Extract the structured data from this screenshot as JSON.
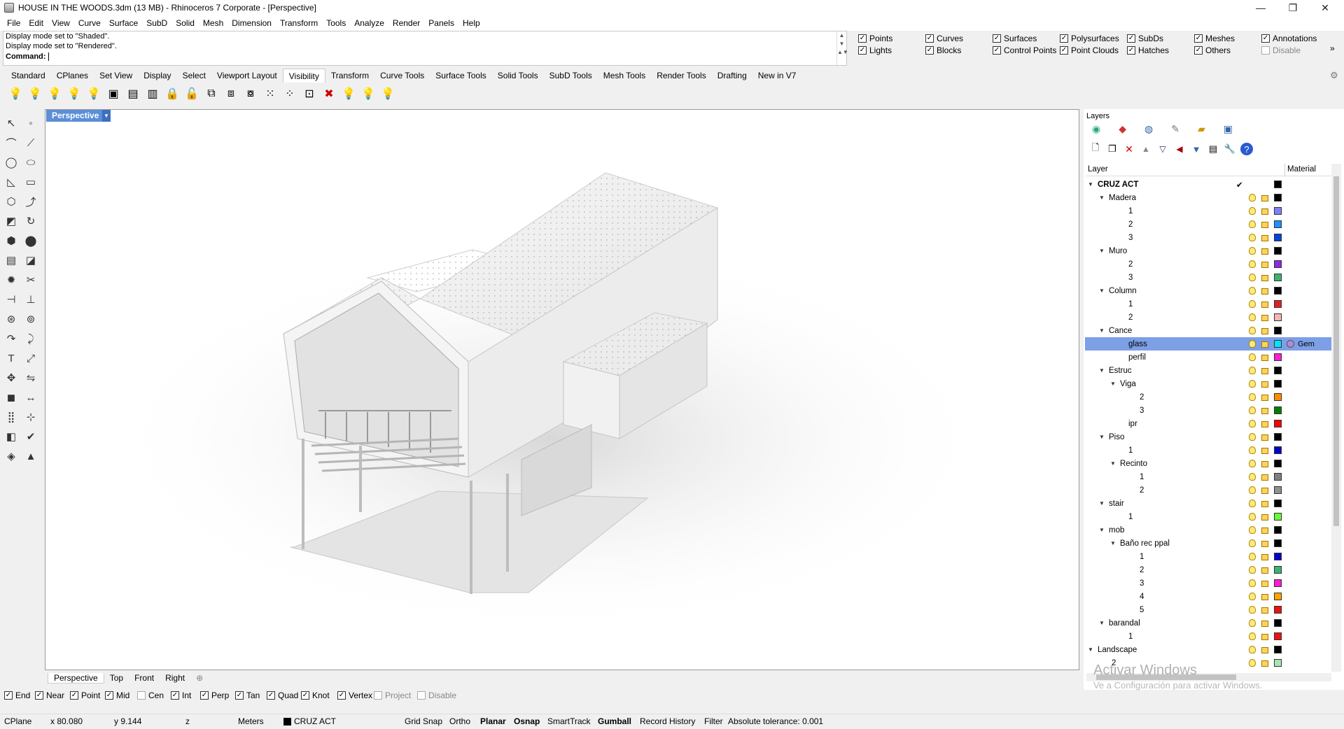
{
  "window": {
    "title": "HOUSE IN THE WOODS.3dm (13 MB) - Rhinoceros 7 Corporate - [Perspective]",
    "min": "—",
    "max": "❐",
    "close": "✕"
  },
  "menu": [
    "File",
    "Edit",
    "View",
    "Curve",
    "Surface",
    "SubD",
    "Solid",
    "Mesh",
    "Dimension",
    "Transform",
    "Tools",
    "Analyze",
    "Render",
    "Panels",
    "Help"
  ],
  "command": {
    "history1": "Display mode set to \"Shaded\".",
    "history2": "Display mode set to \"Rendered\".",
    "prompt": "Command:",
    "value": ""
  },
  "filters": [
    {
      "label": "Points",
      "checked": true
    },
    {
      "label": "Curves",
      "checked": true
    },
    {
      "label": "Surfaces",
      "checked": true
    },
    {
      "label": "Polysurfaces",
      "checked": true
    },
    {
      "label": "SubDs",
      "checked": true
    },
    {
      "label": "Meshes",
      "checked": true
    },
    {
      "label": "Annotations",
      "checked": true
    },
    {
      "label": "Lights",
      "checked": true
    },
    {
      "label": "Blocks",
      "checked": true
    },
    {
      "label": "Control Points",
      "checked": true
    },
    {
      "label": "Point Clouds",
      "checked": true
    },
    {
      "label": "Hatches",
      "checked": true
    },
    {
      "label": "Others",
      "checked": true
    },
    {
      "label": "Disable",
      "checked": false
    }
  ],
  "toolbar_tabs": [
    "Standard",
    "CPlanes",
    "Set View",
    "Display",
    "Select",
    "Viewport Layout",
    "Visibility",
    "Transform",
    "Curve Tools",
    "Surface Tools",
    "Solid Tools",
    "SubD Tools",
    "Mesh Tools",
    "Render Tools",
    "Drafting",
    "New in V7"
  ],
  "active_tab": "Visibility",
  "viewport": {
    "label": "Perspective",
    "tabs": [
      "Perspective",
      "Top",
      "Front",
      "Right"
    ],
    "add": "⊕"
  },
  "osnaps": [
    {
      "label": "End",
      "checked": true
    },
    {
      "label": "Near",
      "checked": true
    },
    {
      "label": "Point",
      "checked": true
    },
    {
      "label": "Mid",
      "checked": true
    },
    {
      "label": "Cen",
      "checked": false
    },
    {
      "label": "Int",
      "checked": true
    },
    {
      "label": "Perp",
      "checked": true
    },
    {
      "label": "Tan",
      "checked": true
    },
    {
      "label": "Quad",
      "checked": true
    },
    {
      "label": "Knot",
      "checked": true
    },
    {
      "label": "Vertex",
      "checked": true
    },
    {
      "label": "Project",
      "checked": false
    },
    {
      "label": "Disable",
      "checked": false
    }
  ],
  "status": {
    "cplane": "CPlane",
    "x": "x 80.080",
    "y": "y 9.144",
    "z": "z",
    "units": "Meters",
    "layer": "CRUZ ACT",
    "grid_snap": "Grid Snap",
    "ortho": "Ortho",
    "planar": "Planar",
    "osnap": "Osnap",
    "smarttrack": "SmartTrack",
    "gumball": "Gumball",
    "record_history": "Record History",
    "filter": "Filter",
    "tolerance": "Absolute tolerance: 0.001"
  },
  "layers_panel": {
    "title": "Layers",
    "col_layer": "Layer",
    "col_material": "Material"
  },
  "layers": [
    {
      "name": "CRUZ ACT",
      "level": 0,
      "expander": "open",
      "bold": true,
      "current": true,
      "color": "#000000"
    },
    {
      "name": "Madera",
      "level": 1,
      "expander": "open",
      "color": "#000000"
    },
    {
      "name": "1",
      "level": 2,
      "color": "#8080ff"
    },
    {
      "name": "2",
      "level": 2,
      "color": "#1e90ff"
    },
    {
      "name": "3",
      "level": 2,
      "color": "#0044dd"
    },
    {
      "name": "Muro",
      "level": 1,
      "expander": "open",
      "color": "#000000"
    },
    {
      "name": "2",
      "level": 2,
      "color": "#8a2be2"
    },
    {
      "name": "3",
      "level": 2,
      "color": "#3cb371"
    },
    {
      "name": "Column",
      "level": 1,
      "expander": "open",
      "color": "#000000"
    },
    {
      "name": "1",
      "level": 2,
      "color": "#e02020"
    },
    {
      "name": "2",
      "level": 2,
      "color": "#f4b6b6"
    },
    {
      "name": "Cance",
      "level": 1,
      "expander": "open",
      "color": "#000000"
    },
    {
      "name": "glass",
      "level": 2,
      "color": "#00e5ff",
      "selected": true,
      "material": "Gem"
    },
    {
      "name": "perfil",
      "level": 2,
      "color": "#ff1cd5"
    },
    {
      "name": "Estruc",
      "level": 1,
      "expander": "open",
      "color": "#000000"
    },
    {
      "name": "Viga",
      "level": 2,
      "expander": "open",
      "color": "#000000"
    },
    {
      "name": "2",
      "level": 3,
      "color": "#ff8c00"
    },
    {
      "name": "3",
      "level": 3,
      "color": "#008000"
    },
    {
      "name": "ipr",
      "level": 2,
      "color": "#ff0000"
    },
    {
      "name": "Piso",
      "level": 1,
      "expander": "open",
      "color": "#000000"
    },
    {
      "name": "1",
      "level": 2,
      "color": "#0000cc"
    },
    {
      "name": "Recinto",
      "level": 2,
      "expander": "open",
      "color": "#000000"
    },
    {
      "name": "1",
      "level": 3,
      "color": "#808080"
    },
    {
      "name": "2",
      "level": 3,
      "color": "#909090"
    },
    {
      "name": "stair",
      "level": 1,
      "expander": "open",
      "color": "#000000"
    },
    {
      "name": "1",
      "level": 2,
      "color": "#66ff33"
    },
    {
      "name": "mob",
      "level": 1,
      "expander": "open",
      "color": "#000000"
    },
    {
      "name": "Baño rec ppal",
      "level": 2,
      "expander": "open",
      "color": "#000000"
    },
    {
      "name": "1",
      "level": 3,
      "color": "#0000cc"
    },
    {
      "name": "2",
      "level": 3,
      "color": "#3cb371"
    },
    {
      "name": "3",
      "level": 3,
      "color": "#ff1cd5"
    },
    {
      "name": "4",
      "level": 3,
      "color": "#ffa500"
    },
    {
      "name": "5",
      "level": 3,
      "color": "#ee1111"
    },
    {
      "name": "barandal",
      "level": 1,
      "expander": "open",
      "color": "#000000"
    },
    {
      "name": "1",
      "level": 2,
      "color": "#ee1111"
    },
    {
      "name": "Landscape",
      "level": 0,
      "expander": "open",
      "color": "#000000"
    },
    {
      "name": "2",
      "level": 1,
      "color": "#a8e6b0"
    }
  ],
  "watermark": {
    "line1": "Activar Windows",
    "line2": "Ve a Configuración para activar Windows."
  }
}
